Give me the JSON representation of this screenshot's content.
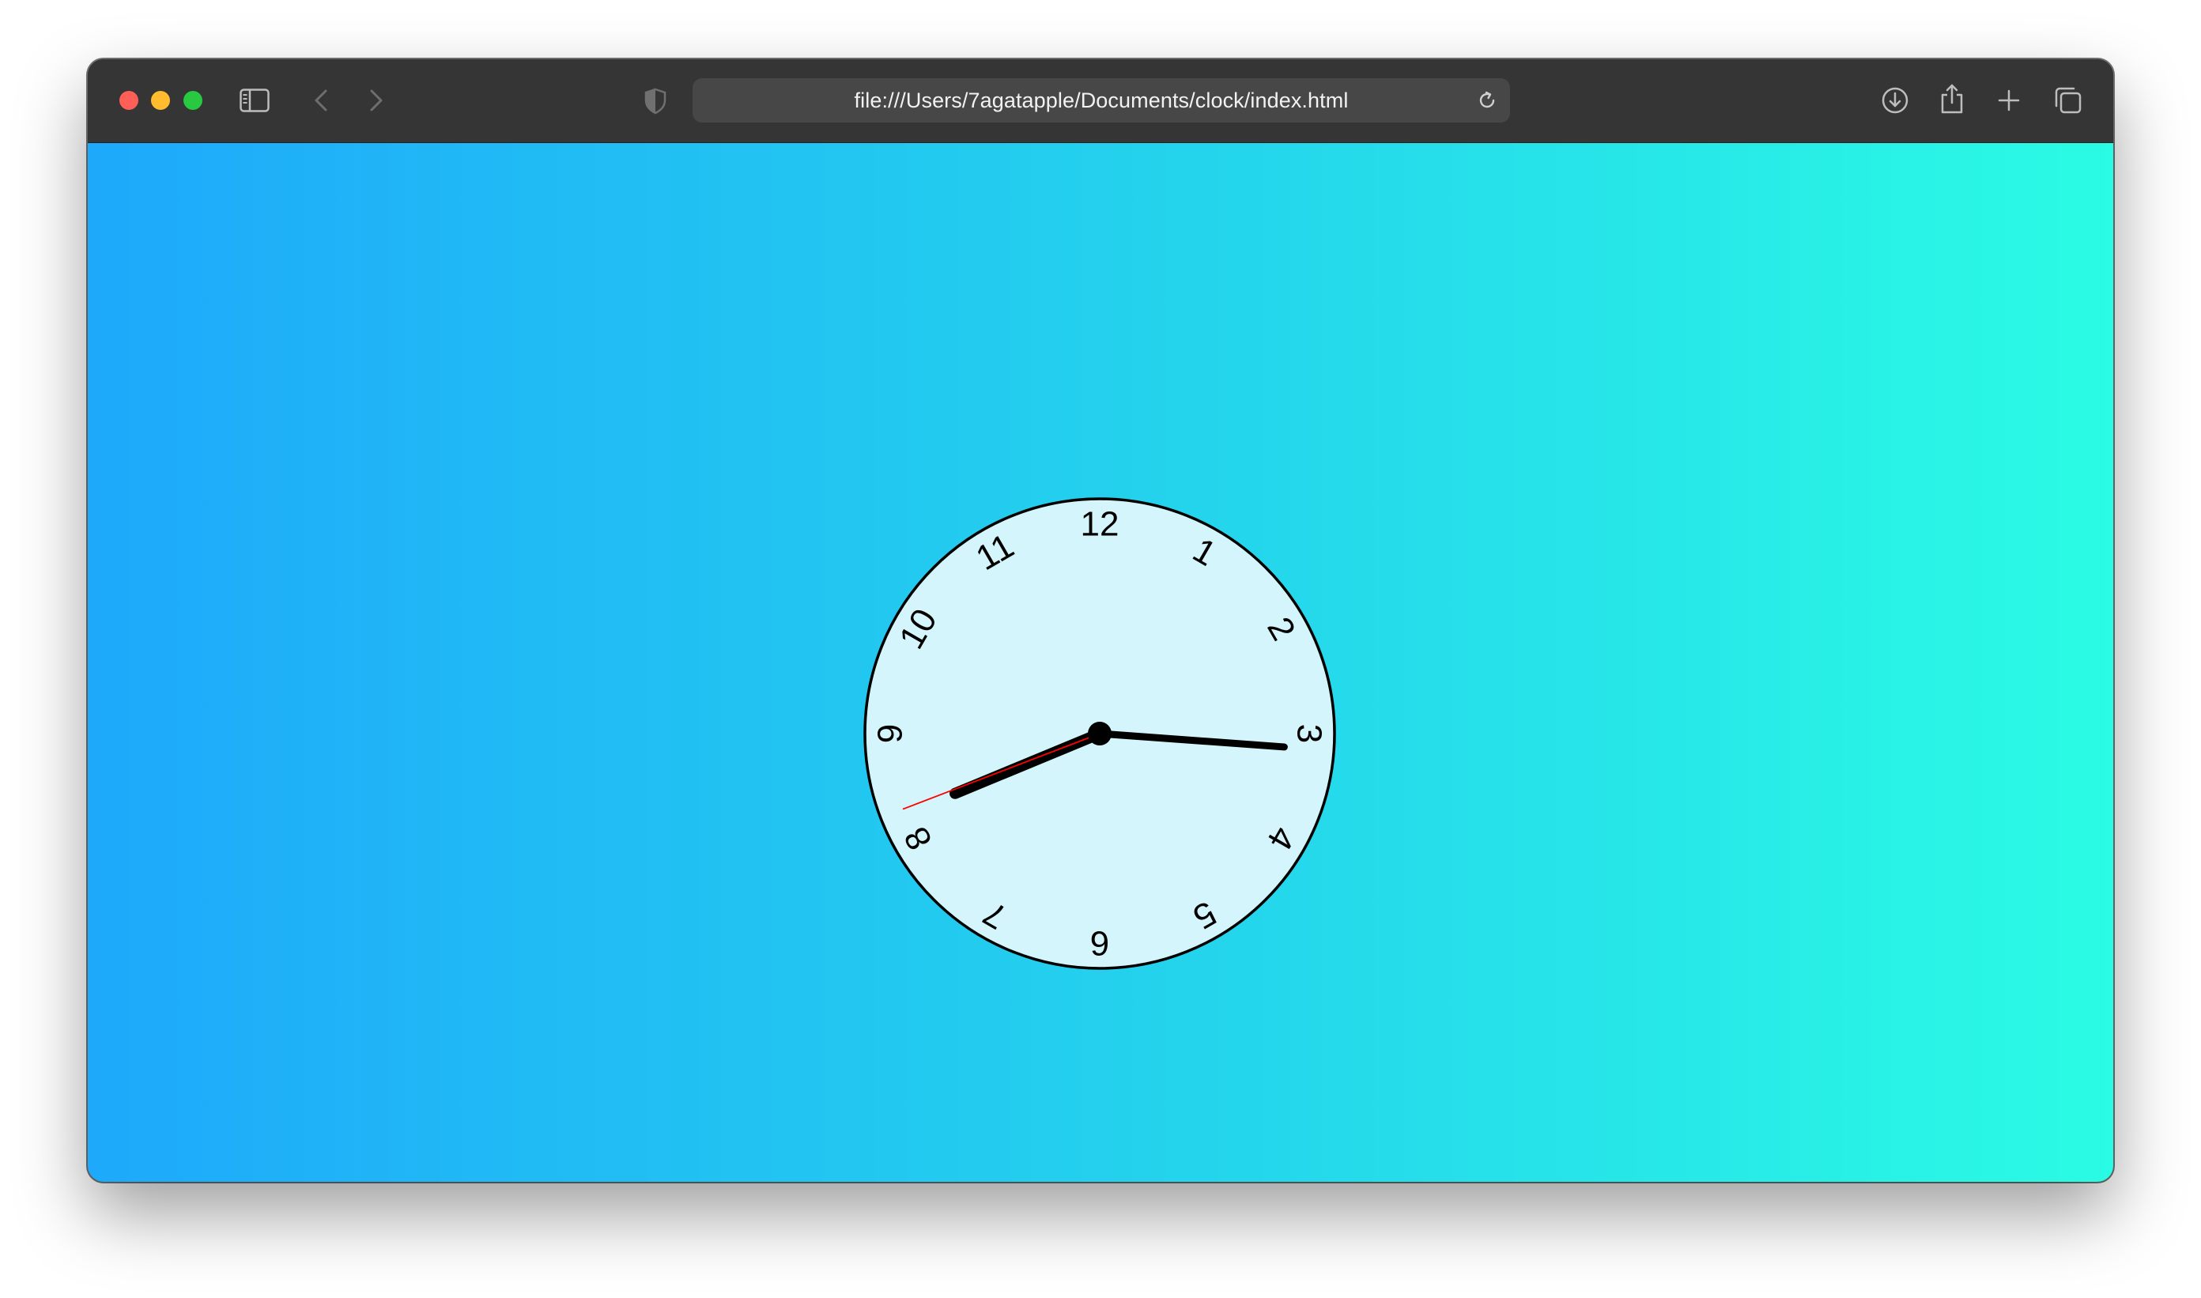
{
  "browser": {
    "url": "file:///Users/7agatapple/Documents/clock/index.html",
    "traffic_lights": {
      "close_color": "#ff5f57",
      "minimize_color": "#febc2e",
      "zoom_color": "#28c840"
    },
    "icons": {
      "sidebar": "sidebar-icon",
      "back": "chevron-left-icon",
      "forward": "chevron-right-icon",
      "privacy": "shield-icon",
      "reload": "reload-icon",
      "download": "download-icon",
      "share": "share-icon",
      "new_tab": "plus-icon",
      "tabs_overview": "tabs-overview-icon"
    }
  },
  "page": {
    "background_gradient": [
      "#1ea9fb",
      "#2afbe4"
    ],
    "clock": {
      "face_color": "#d3f5fb",
      "numerals": [
        "12",
        "1",
        "2",
        "3",
        "4",
        "5",
        "6",
        "7",
        "8",
        "9",
        "10",
        "11"
      ],
      "time": {
        "hours": 8,
        "minutes": 15,
        "seconds": 41.5
      },
      "hand_colors": {
        "hour": "#000000",
        "minute": "#000000",
        "second": "#ff0000"
      }
    }
  }
}
